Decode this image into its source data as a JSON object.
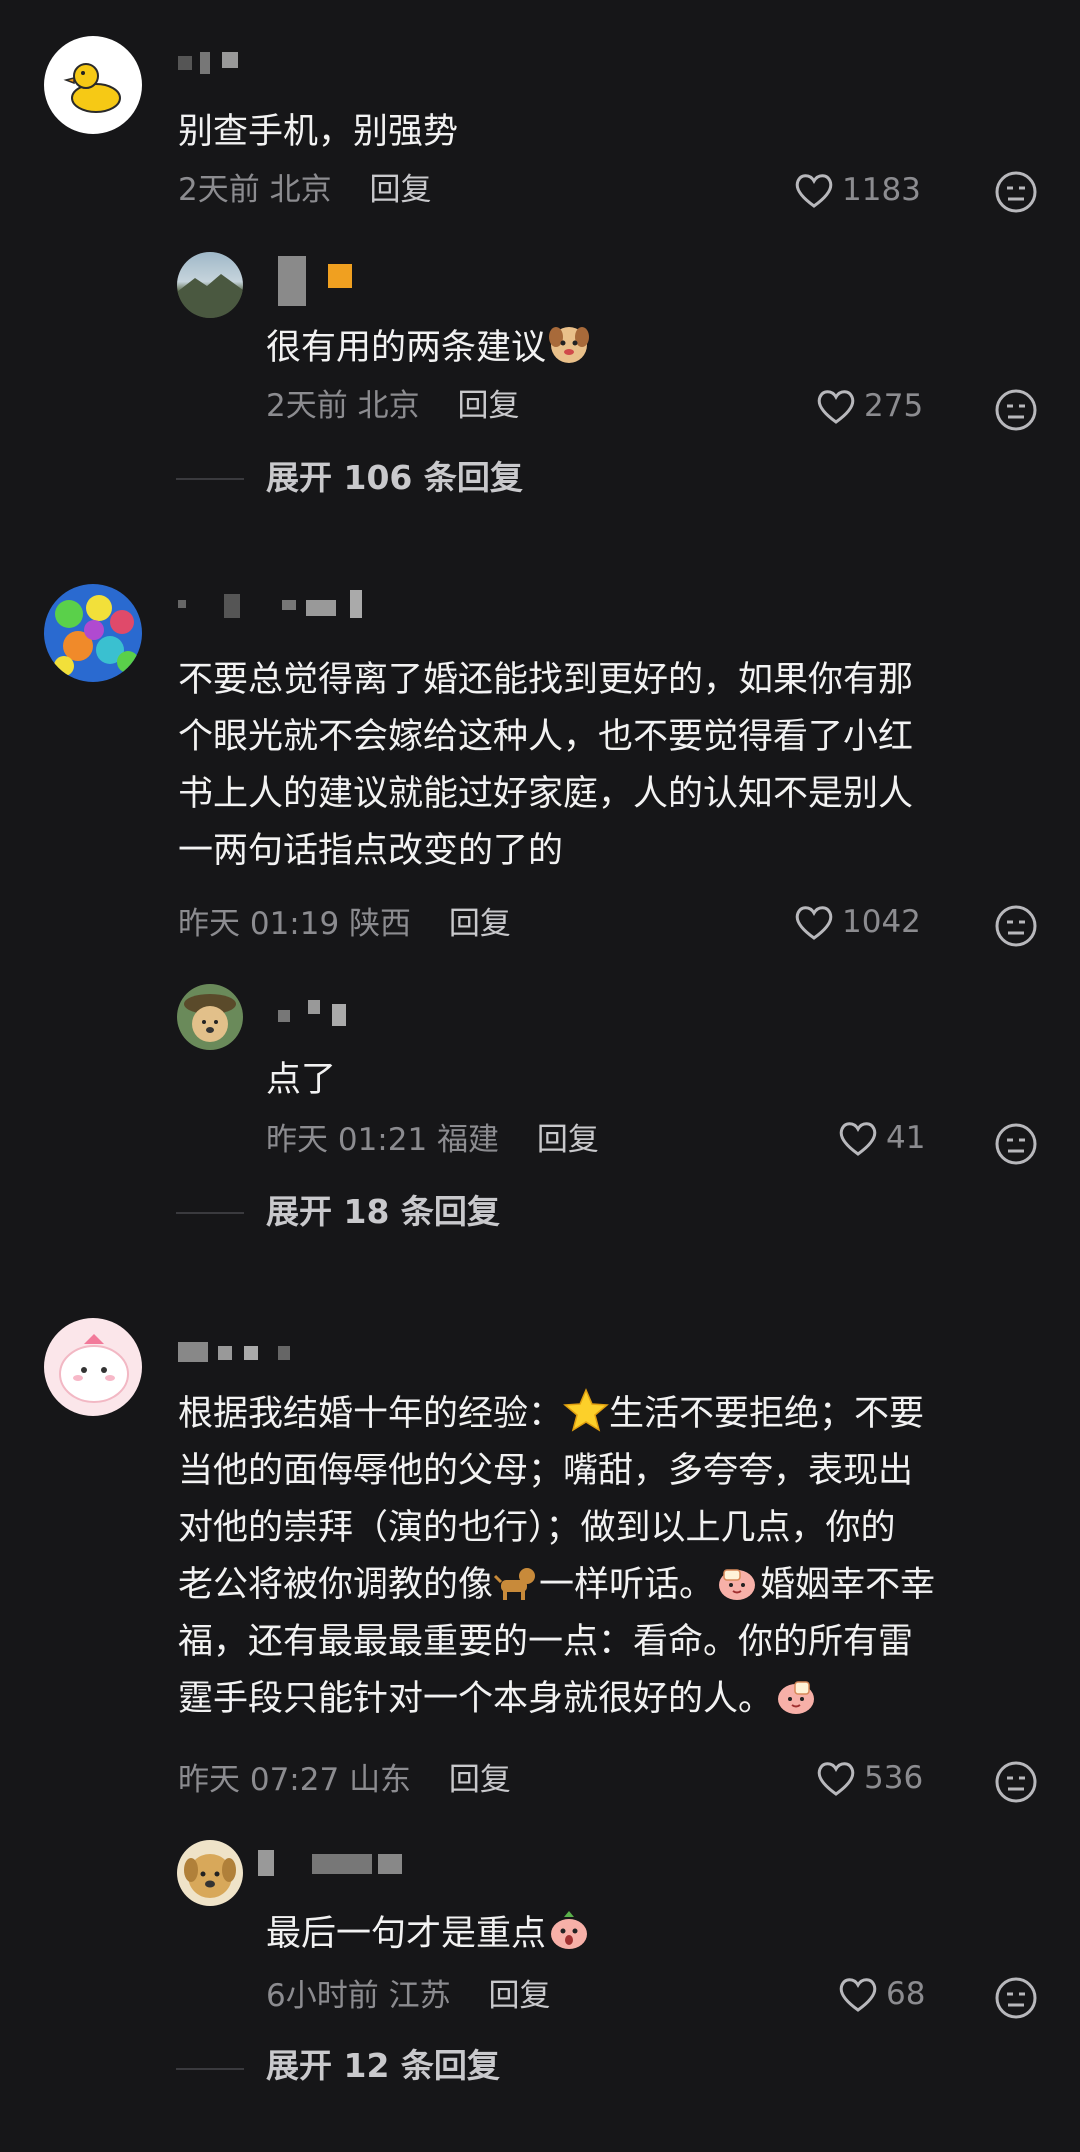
{
  "comments": [
    {
      "text": "别查手机，别强势",
      "time": "2天前",
      "location": "北京",
      "reply_label": "回复",
      "likes": "1183",
      "avatar_icon": "duck-avatar",
      "reply": {
        "text": "很有用的两条建议",
        "time": "2天前",
        "location": "北京",
        "reply_label": "回复",
        "likes": "275",
        "avatar_icon": "landscape-avatar"
      },
      "expand_label": "展开 106 条回复"
    },
    {
      "text": "不要总觉得离了婚还能找到更好的，如果你有那\n个眼光就不会嫁给这种人，也不要觉得看了小红\n书上人的建议就能过好家庭，人的认知不是别人\n一两句话指点改变的了的",
      "time": "昨天 01:19",
      "location": "陕西",
      "reply_label": "回复",
      "likes": "1042",
      "avatar_icon": "cartoon-crowd-avatar",
      "reply": {
        "text": "点了",
        "time": "昨天 01:21",
        "location": "福建",
        "reply_label": "回复",
        "likes": "41",
        "avatar_icon": "dog-avatar"
      },
      "expand_label": "展开 18 条回复"
    },
    {
      "text_lines": [
        "根据我结婚十年的经验：",
        "生活不要拒绝；不要",
        "当他的面侮辱他的父母；嘴甜，多夸夸，表现出",
        "对他的崇拜（演的也行）；做到以上几点，你的",
        "老公将被你调教的像",
        "一样听话。",
        "婚姻幸不幸",
        "福，还有最最最重要的一点：看命。你的所有雷",
        "霆手段只能针对一个本身就很好的人。"
      ],
      "time": "昨天 07:27",
      "location": "山东",
      "reply_label": "回复",
      "likes": "536",
      "avatar_icon": "pink-blob-avatar",
      "reply": {
        "text": "最后一句才是重点",
        "time": "6小时前",
        "location": "江苏",
        "reply_label": "回复",
        "likes": "68",
        "avatar_icon": "golden-dog-avatar"
      },
      "expand_label": "展开 12 条回复"
    }
  ],
  "colors": {
    "background": "#161618",
    "text": "#f2f2f2",
    "meta": "#8c8c90"
  }
}
